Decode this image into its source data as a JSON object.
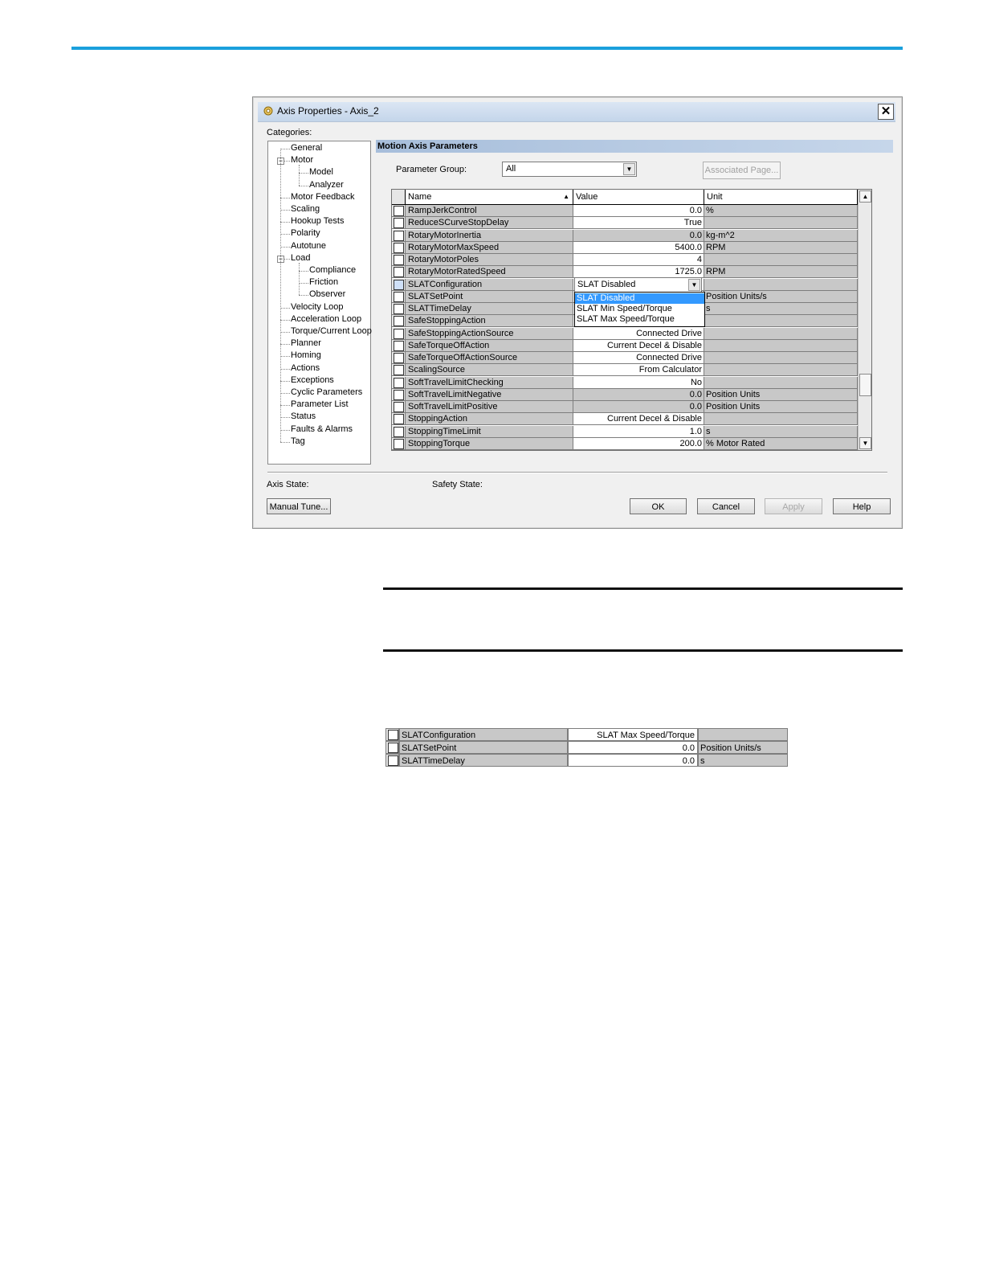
{
  "dialog": {
    "title": "Axis Properties - Axis_2",
    "close_label": "✕",
    "categories_label": "Categories:",
    "section_header": "Motion Axis Parameters",
    "param_group_label": "Parameter Group:",
    "param_group_value": "All",
    "associated_page_label": "Associated Page...",
    "axis_state_label": "Axis State:",
    "safety_state_label": "Safety State:",
    "manual_tune_label": "Manual Tune...",
    "ok_label": "OK",
    "cancel_label": "Cancel",
    "apply_label": "Apply",
    "help_label": "Help"
  },
  "tree": [
    {
      "label": "General"
    },
    {
      "label": "Motor",
      "expander": "−"
    },
    {
      "label": "Model"
    },
    {
      "label": "Analyzer"
    },
    {
      "label": "Motor Feedback"
    },
    {
      "label": "Scaling"
    },
    {
      "label": "Hookup Tests"
    },
    {
      "label": "Polarity"
    },
    {
      "label": "Autotune"
    },
    {
      "label": "Load",
      "expander": "−"
    },
    {
      "label": "Compliance"
    },
    {
      "label": "Friction"
    },
    {
      "label": "Observer"
    },
    {
      "label": "Velocity Loop"
    },
    {
      "label": "Acceleration Loop"
    },
    {
      "label": "Torque/Current Loop"
    },
    {
      "label": "Planner"
    },
    {
      "label": "Homing"
    },
    {
      "label": "Actions"
    },
    {
      "label": "Exceptions"
    },
    {
      "label": "Cyclic Parameters"
    },
    {
      "label": "Parameter List"
    },
    {
      "label": "Status"
    },
    {
      "label": "Faults & Alarms"
    },
    {
      "label": "Tag"
    }
  ],
  "grid": {
    "headers": {
      "name": "Name",
      "value": "Value",
      "unit": "Unit"
    },
    "rows": [
      {
        "name": "RampJerkControl",
        "value": "0.0",
        "unit": "%",
        "editable": true
      },
      {
        "name": "ReduceSCurveStopDelay",
        "value": "True",
        "unit": "",
        "editable": true
      },
      {
        "name": "RotaryMotorInertia",
        "value": "0.0",
        "unit": "kg-m^2",
        "editable": false
      },
      {
        "name": "RotaryMotorMaxSpeed",
        "value": "5400.0",
        "unit": "RPM",
        "editable": true
      },
      {
        "name": "RotaryMotorPoles",
        "value": "4",
        "unit": "",
        "editable": true
      },
      {
        "name": "RotaryMotorRatedSpeed",
        "value": "1725.0",
        "unit": "RPM",
        "editable": true
      },
      {
        "name": "SLATConfiguration",
        "value": "",
        "unit": "",
        "editable": true
      },
      {
        "name": "SLATSetPoint",
        "value": "",
        "unit": "Position Units/s",
        "editable": true
      },
      {
        "name": "SLATTimeDelay",
        "value": "",
        "unit": "s",
        "editable": true
      },
      {
        "name": "SafeStoppingAction",
        "value": "",
        "unit": "",
        "editable": true
      },
      {
        "name": "SafeStoppingActionSource",
        "value": "Connected Drive",
        "unit": "",
        "editable": true
      },
      {
        "name": "SafeTorqueOffAction",
        "value": "Current Decel & Disable",
        "unit": "",
        "editable": true
      },
      {
        "name": "SafeTorqueOffActionSource",
        "value": "Connected Drive",
        "unit": "",
        "editable": true
      },
      {
        "name": "ScalingSource",
        "value": "From Calculator",
        "unit": "",
        "editable": true
      },
      {
        "name": "SoftTravelLimitChecking",
        "value": "No",
        "unit": "",
        "editable": true
      },
      {
        "name": "SoftTravelLimitNegative",
        "value": "0.0",
        "unit": "Position Units",
        "editable": false
      },
      {
        "name": "SoftTravelLimitPositive",
        "value": "0.0",
        "unit": "Position Units",
        "editable": false
      },
      {
        "name": "StoppingAction",
        "value": "Current Decel & Disable",
        "unit": "",
        "editable": true
      },
      {
        "name": "StoppingTimeLimit",
        "value": "1.0",
        "unit": "s",
        "editable": true
      },
      {
        "name": "StoppingTorque",
        "value": "200.0",
        "unit": "% Motor Rated",
        "editable": true
      }
    ],
    "slat_dropdown": {
      "selected": "SLAT Disabled",
      "options": [
        "SLAT Disabled",
        "SLAT Min Speed/Torque",
        "SLAT Max Speed/Torque"
      ]
    }
  },
  "mini_table": [
    {
      "name": "SLATConfiguration",
      "value": "SLAT Max Speed/Torque",
      "unit": "",
      "editable": true
    },
    {
      "name": "SLATSetPoint",
      "value": "0.0",
      "unit": "Position Units/s",
      "editable": true
    },
    {
      "name": "SLATTimeDelay",
      "value": "0.0",
      "unit": "s",
      "editable": true
    }
  ],
  "colors": {
    "accent_rule": "#1aa0dc",
    "selection": "#3399ff"
  }
}
